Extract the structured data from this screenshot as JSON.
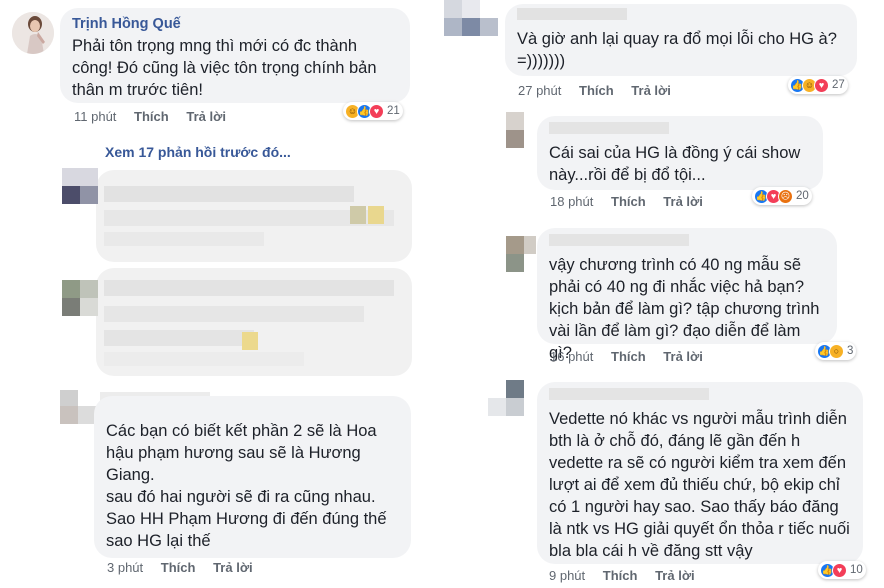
{
  "comments_left": {
    "c1": {
      "author": "Trịnh Hồng Quế",
      "text": "Phải tôn trọng mng thì mới có đc thành công! Đó cũng là việc tôn trọng chính bản thân m trước tiên!",
      "time": "11 phút",
      "like": "Thích",
      "reply": "Trả lời",
      "reactions_count": "21"
    },
    "see_more": "Xem 17 phản hồi trước đó...",
    "c4": {
      "text": "Các bạn có biết kết phần 2 sẽ là Hoa hậu phạm hương sau sẽ là Hương Giang.\nsau đó hai người sẽ đi ra cũng nhau.\nSao HH Phạm Hương đi đến đúng thế sao HG lại thế",
      "time": "3 phút",
      "like": "Thích",
      "reply": "Trả lời"
    }
  },
  "comments_right": {
    "r1": {
      "text": "Và giờ anh lại quay ra đổ mọi lỗi cho HG à?\n=)))))))",
      "time": "27 phút",
      "like": "Thích",
      "reply": "Trả lời",
      "reactions_count": "27"
    },
    "r2": {
      "text": "Cái sai của HG là đồng ý cái show này...rồi để bị đổ tội...",
      "time": "18 phút",
      "like": "Thích",
      "reply": "Trả lời",
      "reactions_count": "20"
    },
    "r3": {
      "text": "vậy chương trình có 40 ng mẫu sẽ phải có 40 ng đi nhắc việc hả bạn? kịch bản để làm gì? tập chương trình vài lần để làm gì? đạo diễn để làm gì?",
      "time": "16 phút",
      "like": "Thích",
      "reply": "Trả lời",
      "reactions_count": "3"
    },
    "r4": {
      "text": "Vedette nó khác vs người mẫu trình diễn bth là ở chỗ đó, đáng lẽ gần đến h vedette ra sẽ có người kiểm tra xem đến lượt ai để xem đủ thiếu chứ, bộ ekip chỉ có 1 người hay sao. Sao thấy báo đăng là ntk vs HG giải quyết ổn thỏa r tiếc nuối bla bla cái h về đăng stt vậy",
      "time": "9 phút",
      "like": "Thích",
      "reply": "Trả lời",
      "reactions_count": "10"
    }
  },
  "icons": {
    "like": "like-icon",
    "love": "love-icon",
    "haha": "haha-icon",
    "wow": "wow-icon",
    "angry": "angry-icon"
  },
  "colors": {
    "bubble": "#f2f3f5",
    "link": "#385898",
    "meta": "#606770",
    "like": "#1877f2",
    "love": "#f33e58"
  }
}
